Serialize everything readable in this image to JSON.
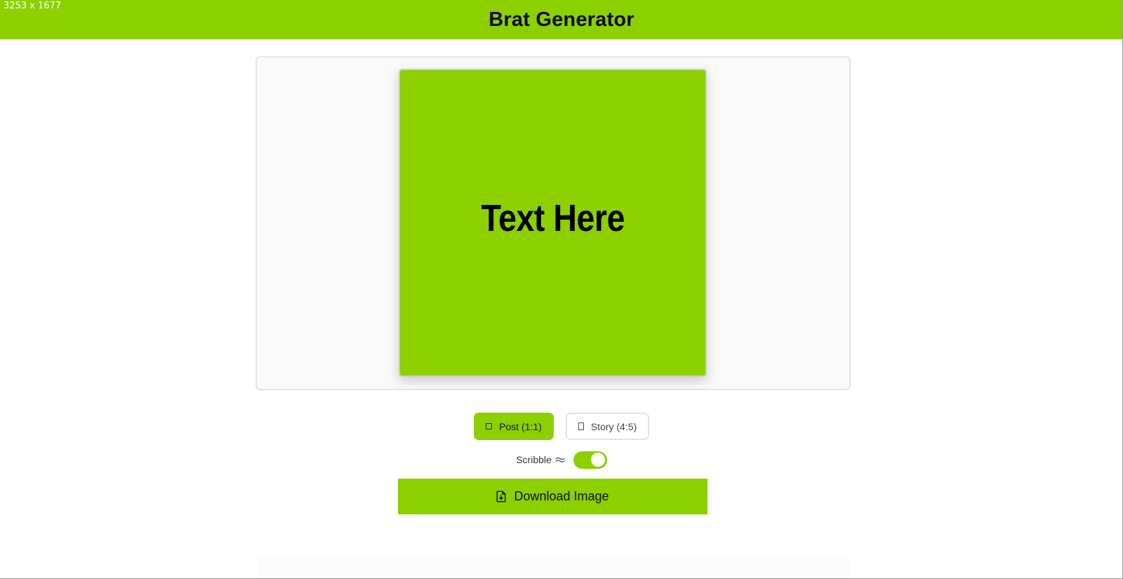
{
  "overlay": {
    "dimensions": "3253 x 1677"
  },
  "header": {
    "title": "Brat Generator"
  },
  "preview": {
    "text": "Text Here"
  },
  "formats": [
    {
      "label": "Post (1:1)",
      "icon": "square-icon",
      "selected": true
    },
    {
      "label": "Story (4:5)",
      "icon": "portrait-rect-icon",
      "selected": false
    }
  ],
  "scribble": {
    "label": "Scribble",
    "icon": "wavy-lines-icon",
    "enabled": true
  },
  "download": {
    "label": "Download Image",
    "icon": "file-download-icon"
  },
  "colors": {
    "accent": "#8cd000",
    "frame_background": "#f9f9fa",
    "frame_border": "#e4e4e7",
    "text": "#000000"
  }
}
